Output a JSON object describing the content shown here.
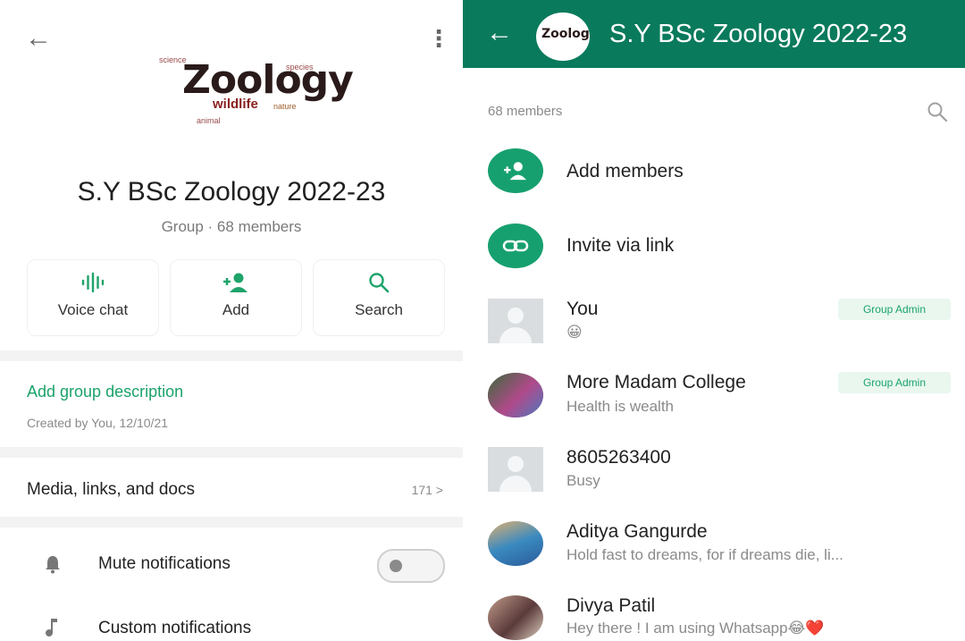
{
  "left": {
    "group_name": "S.Y BSc Zoology 2022-23",
    "group_meta": "Group · 68 members",
    "logo": {
      "main": "Zoology",
      "sub": "wildlife",
      "words": [
        "nature",
        "animal",
        "science",
        "species"
      ]
    },
    "actions": [
      {
        "label": "Voice chat",
        "icon": "voice-wave-icon"
      },
      {
        "label": "Add",
        "icon": "add-person-icon"
      },
      {
        "label": "Search",
        "icon": "search-icon"
      }
    ],
    "add_description": "Add group description",
    "created": "Created by You, 12/10/21",
    "media": {
      "label": "Media, links, and docs",
      "count": "171 >"
    },
    "settings": [
      {
        "label": "Mute notifications",
        "icon": "bell-icon",
        "toggle": "off"
      },
      {
        "label": "Custom notifications",
        "icon": "music-note-icon"
      }
    ]
  },
  "right": {
    "header": {
      "title": "S.Y BSc Zoology 2022-23",
      "avatar_text": "Zoology"
    },
    "members_count": "68 members",
    "actions": [
      {
        "label": "Add members",
        "icon": "add-person-icon"
      },
      {
        "label": "Invite via link",
        "icon": "link-icon"
      }
    ],
    "members": [
      {
        "name": "You",
        "status": "😀",
        "badge": "Group Admin",
        "avatar": "default"
      },
      {
        "name": "More Madam College",
        "status": "Health is wealth",
        "badge": "Group Admin",
        "avatar": "photo"
      },
      {
        "name": "8605263400",
        "status": "Busy",
        "badge": "",
        "avatar": "default"
      },
      {
        "name": "Aditya Gangurde",
        "status": "Hold fast to dreams, for if dreams die, li...",
        "badge": "",
        "avatar": "photo"
      },
      {
        "name": "Divya Patil",
        "status": "Hey there ! I am using Whatsapp😂❤️",
        "badge": "",
        "avatar": "photo"
      }
    ]
  },
  "colors": {
    "accent": "#1aa36a",
    "header": "#0a7a5c"
  }
}
